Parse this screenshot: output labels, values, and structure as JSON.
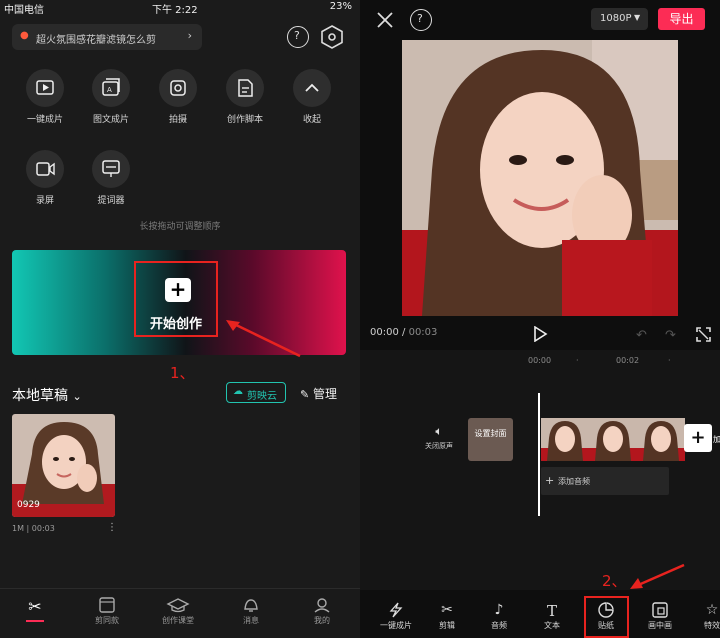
{
  "left": {
    "status": {
      "carrier": "中国电信",
      "time": "下午 2:22",
      "battery": "23%"
    },
    "search": {
      "placeholder": "超火氛围感花瓣滤镜怎么剪"
    },
    "tools": [
      {
        "label": "一键成片",
        "icon": "play-box-icon"
      },
      {
        "label": "图文成片",
        "icon": "image-text-icon"
      },
      {
        "label": "拍摄",
        "icon": "camera-icon"
      },
      {
        "label": "创作脚本",
        "icon": "script-icon"
      },
      {
        "label": "收起",
        "icon": "chevron-up-icon"
      },
      {
        "label": "录屏",
        "icon": "screen-record-icon"
      },
      {
        "label": "提词器",
        "icon": "teleprompter-icon"
      }
    ],
    "hint": "长按拖动可调整顺序",
    "start_label": "开始创作",
    "annotation_1": "1、",
    "drafts_title": "本地草稿",
    "cloud_label": "剪映云",
    "manage_label": "管理",
    "draft": {
      "caption": "0929",
      "size": "1M",
      "duration": "00:03"
    },
    "tabs": [
      {
        "label": "",
        "icon": "scissors-icon"
      },
      {
        "label": "剪同款",
        "icon": "template-icon"
      },
      {
        "label": "创作课堂",
        "icon": "graduation-cap-icon"
      },
      {
        "label": "消息",
        "icon": "bell-icon"
      },
      {
        "label": "我的",
        "icon": "profile-icon"
      }
    ]
  },
  "right": {
    "resolution": "1080P",
    "export_label": "导出",
    "time_current": "00:00",
    "time_total": "00:03",
    "ruler": [
      "00:00",
      "00:02"
    ],
    "mute_label": "关闭原声",
    "cover_label": "设置封面",
    "add_audio_label": "添加音频",
    "add_clip_label": "加",
    "annotation_2": "2、",
    "tabs": [
      {
        "label": "一键成片",
        "icon": "lightning-icon"
      },
      {
        "label": "剪辑",
        "icon": "scissors-icon"
      },
      {
        "label": "音频",
        "icon": "music-note-icon"
      },
      {
        "label": "文本",
        "icon": "text-icon"
      },
      {
        "label": "贴纸",
        "icon": "sticker-icon"
      },
      {
        "label": "画中画",
        "icon": "picture-in-picture-icon"
      },
      {
        "label": "特效",
        "icon": "effects-star-icon"
      }
    ]
  },
  "colors": {
    "accent": "#fc2c55",
    "annotation": "#e8231f",
    "cloud": "#22c4b0"
  }
}
